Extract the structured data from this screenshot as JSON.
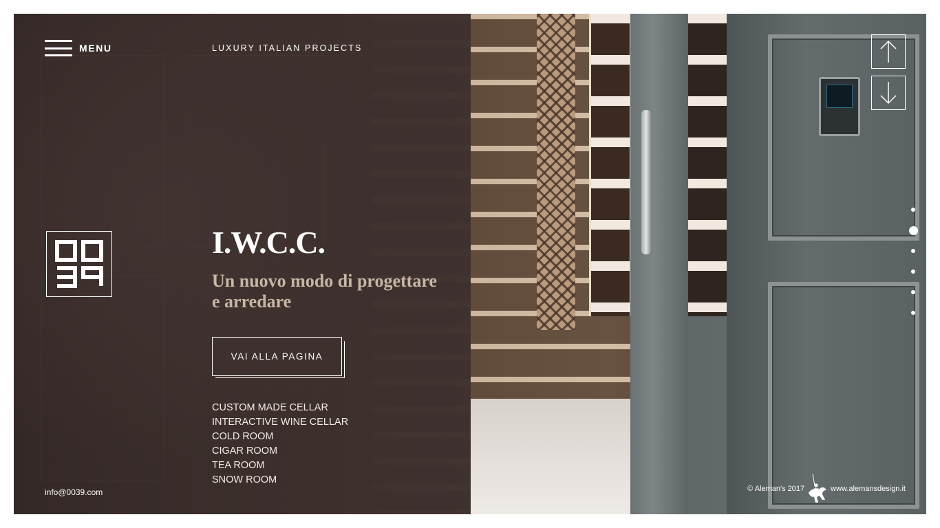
{
  "menu": {
    "label": "MENU"
  },
  "header": {
    "tagline": "LUXURY ITALIAN PROJECTS"
  },
  "brand": {
    "logo_icon": "0039-logo-icon",
    "logo_text": "00 39"
  },
  "hero": {
    "title": "I.W.C.C.",
    "subtitle": "Un nuovo modo di progettare e arredare",
    "cta_label": "VAI ALLA PAGINA"
  },
  "services": [
    "CUSTOM MADE CELLAR",
    "INTERACTIVE WINE CELLAR",
    "COLD ROOM",
    "CIGAR ROOM",
    "TEA ROOM",
    "SNOW ROOM"
  ],
  "contact": {
    "email": "info@0039.com"
  },
  "navigation": {
    "up_icon": "arrow-up-icon",
    "down_icon": "arrow-down-icon",
    "slide_count": 6,
    "active_slide": 2
  },
  "footer": {
    "copyright": "© Aleman's 2017",
    "site": "www.alemansdesign.it",
    "mark_icon": "horse-rider-icon"
  },
  "colors": {
    "overlay": "#3a2c29",
    "subtitle": "#c8b6a4",
    "text": "#ffffff"
  }
}
